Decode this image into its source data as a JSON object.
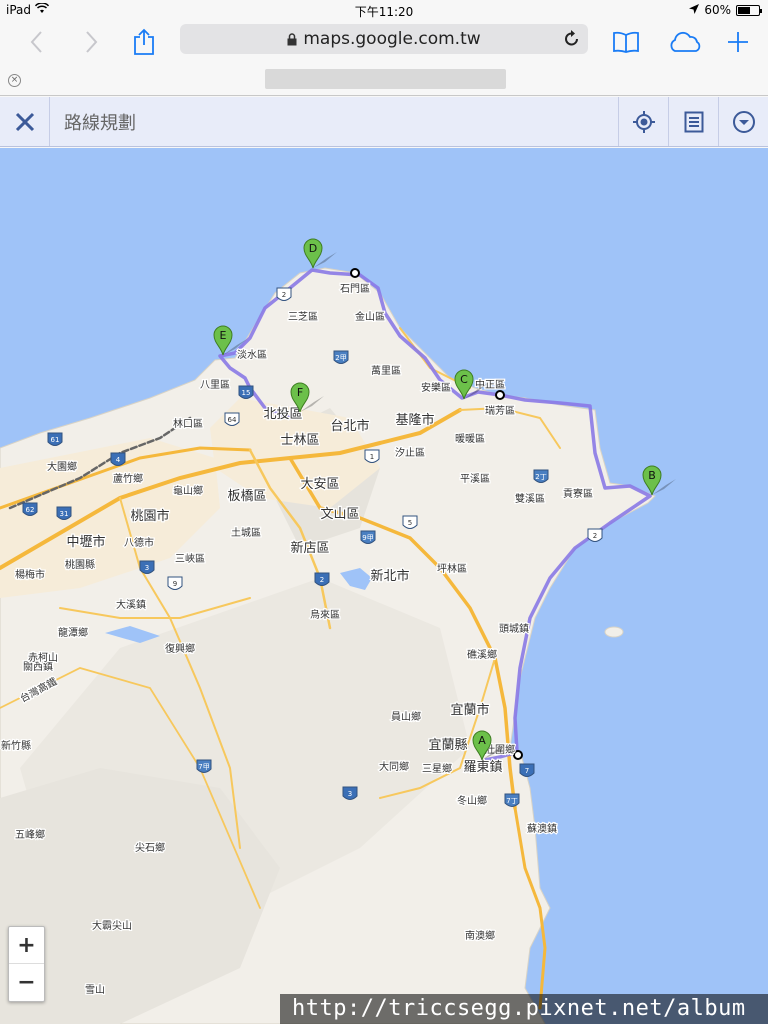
{
  "status_bar": {
    "device": "iPad",
    "time": "下午11:20",
    "battery": "60%",
    "battery_level": 0.6
  },
  "browser": {
    "url": "maps.google.com.tw"
  },
  "app_bar": {
    "title": "路線規劃"
  },
  "markers": [
    {
      "id": "A",
      "label": "A"
    },
    {
      "id": "B",
      "label": "B"
    },
    {
      "id": "C",
      "label": "C"
    },
    {
      "id": "D",
      "label": "D"
    },
    {
      "id": "E",
      "label": "E"
    },
    {
      "id": "F",
      "label": "F"
    }
  ],
  "place_labels": [
    {
      "id": "shimen",
      "text": "石門區"
    },
    {
      "id": "sanzhi",
      "text": "三芝區"
    },
    {
      "id": "jinshan",
      "text": "金山區"
    },
    {
      "id": "tamsui",
      "text": "淡水區"
    },
    {
      "id": "wanli",
      "text": "萬里區"
    },
    {
      "id": "anle",
      "text": "安樂區"
    },
    {
      "id": "zhongzheng",
      "text": "中正區"
    },
    {
      "id": "bali",
      "text": "八里區"
    },
    {
      "id": "beitou",
      "text": "北投區"
    },
    {
      "id": "taipei",
      "text": "台北市"
    },
    {
      "id": "keelung",
      "text": "基隆市"
    },
    {
      "id": "ruifang",
      "text": "瑞芳區"
    },
    {
      "id": "linkou",
      "text": "林口區"
    },
    {
      "id": "shilin",
      "text": "士林區"
    },
    {
      "id": "nuannuan",
      "text": "暖暖區"
    },
    {
      "id": "xizhi",
      "text": "汐止區"
    },
    {
      "id": "dayuan",
      "text": "大園鄉"
    },
    {
      "id": "luzhu",
      "text": "蘆竹鄉"
    },
    {
      "id": "guishan",
      "text": "龜山鄉"
    },
    {
      "id": "banqiao",
      "text": "板橋區"
    },
    {
      "id": "daan",
      "text": "大安區"
    },
    {
      "id": "pingxi",
      "text": "平溪區"
    },
    {
      "id": "shuangxi",
      "text": "雙溪區"
    },
    {
      "id": "gongliao",
      "text": "貢寮區"
    },
    {
      "id": "taoyuan",
      "text": "桃園市"
    },
    {
      "id": "tucheng",
      "text": "土城區"
    },
    {
      "id": "wenshan",
      "text": "文山區"
    },
    {
      "id": "zhongli",
      "text": "中壢市"
    },
    {
      "id": "bade",
      "text": "八德市"
    },
    {
      "id": "sanxia",
      "text": "三峽區"
    },
    {
      "id": "xindian",
      "text": "新店區"
    },
    {
      "id": "newtaipei",
      "text": "新北市"
    },
    {
      "id": "taoyuancounty",
      "text": "桃園縣"
    },
    {
      "id": "yangmei",
      "text": "楊梅市"
    },
    {
      "id": "pinglin",
      "text": "坪林區"
    },
    {
      "id": "daxi",
      "text": "大溪鎮"
    },
    {
      "id": "wulai",
      "text": "烏來區"
    },
    {
      "id": "longtan",
      "text": "龍潭鄉"
    },
    {
      "id": "fuxing",
      "text": "復興鄉"
    },
    {
      "id": "toucheng",
      "text": "頭城鎮"
    },
    {
      "id": "jiaoxi",
      "text": "礁溪鄉"
    },
    {
      "id": "guanxi",
      "text": "關西鎮"
    },
    {
      "id": "yilancity",
      "text": "宜蘭市"
    },
    {
      "id": "yuanshan",
      "text": "員山鄉"
    },
    {
      "id": "yilancounty",
      "text": "宜蘭縣"
    },
    {
      "id": "zhuangwei",
      "text": "壯圍鄉"
    },
    {
      "id": "xinzhu",
      "text": "新竹縣"
    },
    {
      "id": "luodong",
      "text": "羅東鎮"
    },
    {
      "id": "datong",
      "text": "大同鄉"
    },
    {
      "id": "sanxing",
      "text": "三星鄉"
    },
    {
      "id": "dongshan",
      "text": "冬山鄉"
    },
    {
      "id": "suao",
      "text": "蘇澳鎮"
    },
    {
      "id": "wufeng",
      "text": "五峰鄉"
    },
    {
      "id": "jianshi",
      "text": "尖石鄉"
    },
    {
      "id": "nanao",
      "text": "南澳鄉"
    },
    {
      "id": "dabajian",
      "text": "大霸尖山"
    },
    {
      "id": "snowmtn",
      "text": "雪山"
    },
    {
      "id": "highway",
      "text": "台灣高鐵"
    },
    {
      "id": "chitu",
      "text": "赤柯山"
    }
  ],
  "road_shields": [
    "2",
    "2甲",
    "15",
    "64",
    "61",
    "4",
    "1",
    "62",
    "2丁",
    "5",
    "31",
    "3",
    "9",
    "9甲",
    "2",
    "2",
    "7",
    "7丁",
    "7甲",
    "3"
  ],
  "zoom": {
    "in": "+",
    "out": "−"
  },
  "watermark": "http://triccsegg.pixnet.net/album",
  "colors": {
    "sea": "#9fc3f8",
    "land": "#f2efe9",
    "route": "#8a79e6",
    "highway": "#f5b83c",
    "marker": "#6cc04a"
  }
}
